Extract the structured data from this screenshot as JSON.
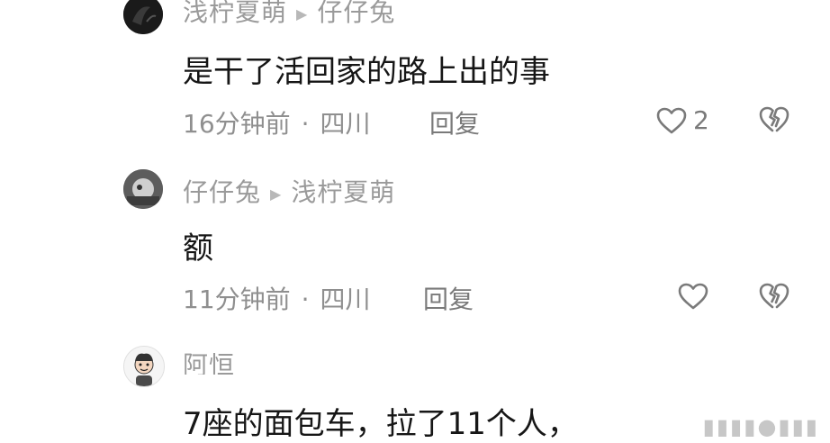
{
  "comments": [
    {
      "author": "浅柠夏萌",
      "reply_to": "仔仔兔",
      "content": "是干了活回家的路上出的事",
      "time": "16分钟前",
      "location": "四川",
      "reply_label": "回复",
      "like_count": "2"
    },
    {
      "author": "仔仔兔",
      "reply_to": "浅柠夏萌",
      "content": "额",
      "time": "11分钟前",
      "location": "四川",
      "reply_label": "回复",
      "like_count": ""
    },
    {
      "author": "阿恒",
      "reply_to": "",
      "content": "7座的面包车，拉了11个人，",
      "time": "",
      "location": "",
      "reply_label": "",
      "like_count": ""
    }
  ],
  "icons": {
    "like": "heart-outline-icon",
    "dislike": "broken-heart-icon",
    "separator": "triangle-right-icon"
  },
  "colors": {
    "text": "#161616",
    "muted": "#9a9a9a",
    "icon": "#7a7a7a"
  }
}
